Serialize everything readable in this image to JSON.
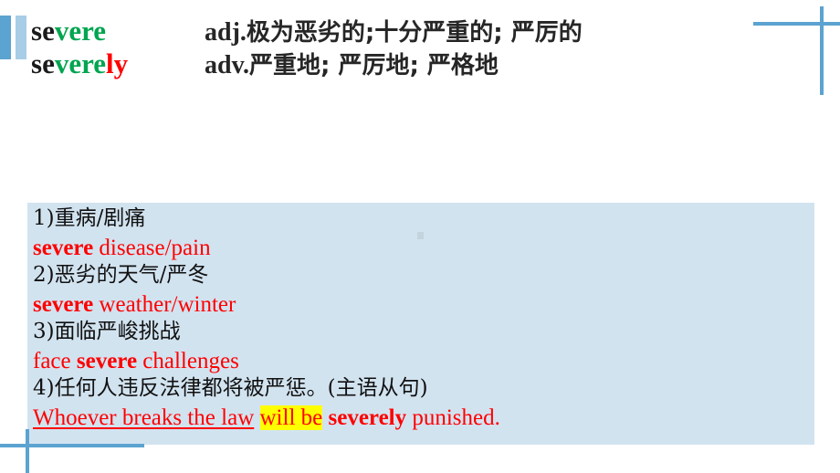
{
  "slide": {
    "background_color": "#ffffff",
    "accent_color_dark": "#5ba3d0",
    "accent_color_light": "#a8cde6",
    "panel_color": "#d2e3f0",
    "highlight_color": "#ffff00",
    "red": "#ff0000",
    "green": "#00a550"
  },
  "heading": {
    "row1": {
      "word_part_black": "se",
      "word_part_green": "vere",
      "word_part_red": "",
      "pos": "adj.",
      "definition": "极为恶劣的;十分严重的; 严厉的"
    },
    "row2": {
      "word_part_black": "se",
      "word_part_green": "vere",
      "word_part_red": "ly",
      "pos": "adv.",
      "definition": "严重地; 严厉地; 严格地"
    }
  },
  "panel": {
    "items": [
      {
        "index": "1)",
        "chinese": "重病/剧痛"
      },
      {
        "index": "2)",
        "chinese": "恶劣的天气/严冬"
      },
      {
        "index": "3)",
        "chinese": "面临严峻挑战"
      },
      {
        "index": "4)",
        "chinese": "任何人违反法律都将被严惩。(主语从句)"
      }
    ],
    "line1_cn": "1)重病/剧痛",
    "line2_bold": "severe",
    "line2_rest": " disease/pain",
    "line3_cn": "2)恶劣的天气/严冬",
    "line4_bold": "severe",
    "line4_rest": " weather/winter",
    "line5_cn": "3)面临严峻挑战",
    "line6_pre": "face ",
    "line6_bold": "severe",
    "line6_rest": " challenges",
    "line7_cn": "4)任何人违反法律都将被严惩。(主语从句)",
    "line8_underlined": "Whoever breaks the law",
    "line8_highlight": "will be",
    "line8_bold": "severely",
    "line8_tail": " punished."
  }
}
